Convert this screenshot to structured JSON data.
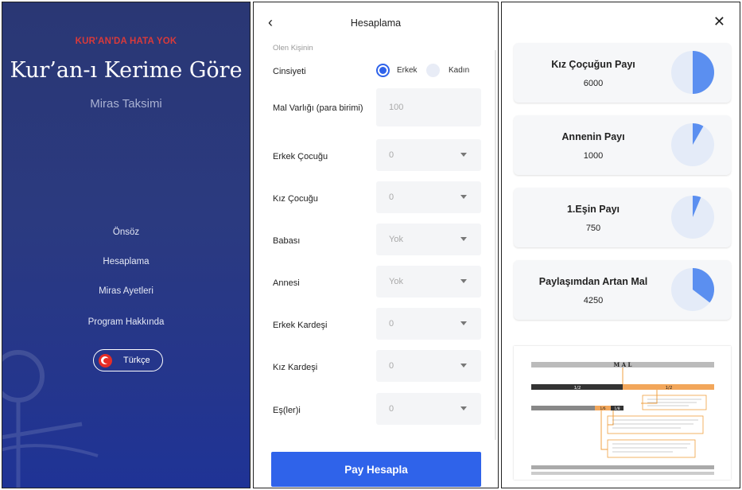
{
  "splash": {
    "warning": "KUR'AN'DA HATA YOK",
    "title": "Kur’an-ı Kerime Göre",
    "subtitle": "Miras Taksimi",
    "menu": [
      "Önsöz",
      "Hesaplama",
      "Miras Ayetleri",
      "Program Hakkında"
    ],
    "language": "Türkçe"
  },
  "form": {
    "title": "Hesaplama",
    "section_label": "Olen Kişinin",
    "gender_label": "Cinsiyeti",
    "gender_options": [
      "Erkek",
      "Kadın"
    ],
    "gender_selected": "Erkek",
    "rows": [
      {
        "label": "Mal Varlığı (para birimi)",
        "value": "100",
        "dropdown": false
      },
      {
        "label": "Erkek Çocuğu",
        "value": "0",
        "dropdown": true
      },
      {
        "label": "Kız Çocuğu",
        "value": "0",
        "dropdown": true
      },
      {
        "label": "Babası",
        "value": "Yok",
        "dropdown": true
      },
      {
        "label": "Annesi",
        "value": "Yok",
        "dropdown": true
      },
      {
        "label": "Erkek Kardeşi",
        "value": "0",
        "dropdown": true
      },
      {
        "label": "Kız Kardeşi",
        "value": "0",
        "dropdown": true
      },
      {
        "label": "Eş(ler)i",
        "value": "0",
        "dropdown": true
      }
    ],
    "submit": "Pay Hesapla"
  },
  "results": {
    "cards": [
      {
        "name": "Kız Çoçuğun Payı",
        "value": "6000",
        "share": 0.5
      },
      {
        "name": "Annenin Payı",
        "value": "1000",
        "share": 0.083
      },
      {
        "name": "1.Eşin Payı",
        "value": "750",
        "share": 0.0625
      },
      {
        "name": "Paylaşımdan Artan Mal",
        "value": "4250",
        "share": 0.354
      }
    ],
    "diagram_heading": "M A L",
    "diagram_labels": [
      "1/2",
      "1/2",
      "1/6",
      "1/8"
    ]
  },
  "colors": {
    "accent": "#2f63ea",
    "pie_fill": "#5b8ff0",
    "pie_bg": "#e4ebf8",
    "warning": "#d93a3a",
    "diagram_orange": "#f2a65a"
  }
}
